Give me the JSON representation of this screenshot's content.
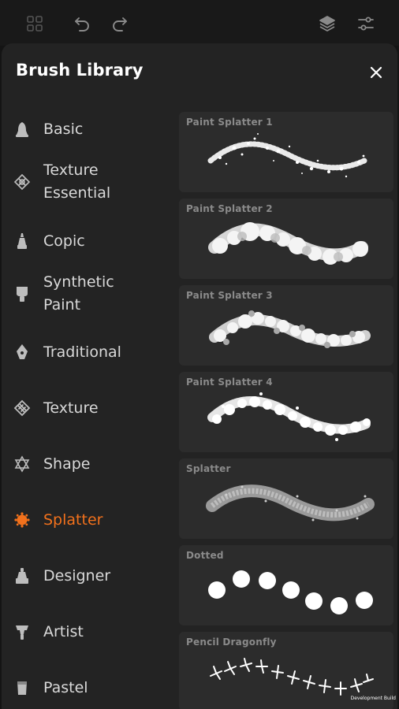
{
  "toolbar": {
    "icons": [
      "grid-icon",
      "undo-icon",
      "redo-icon",
      "layers-icon",
      "adjust-icon"
    ]
  },
  "panel": {
    "title": "Brush Library",
    "close_icon": "close-icon"
  },
  "categories": [
    {
      "label": "Basic",
      "icon": "bell-brush-icon",
      "active": false
    },
    {
      "label": "Texture\nEssential",
      "icon": "texture-essential-icon",
      "active": false
    },
    {
      "label": "Copic",
      "icon": "copic-marker-icon",
      "active": false
    },
    {
      "label": "Synthetic\nPaint",
      "icon": "paint-brush-icon",
      "active": false
    },
    {
      "label": "Traditional",
      "icon": "pen-nib-icon",
      "active": false
    },
    {
      "label": "Texture",
      "icon": "texture-icon",
      "active": false
    },
    {
      "label": "Shape",
      "icon": "shape-icon",
      "active": false
    },
    {
      "label": "Splatter",
      "icon": "splatter-icon",
      "active": true
    },
    {
      "label": "Designer",
      "icon": "designer-icon",
      "active": false
    },
    {
      "label": "Artist",
      "icon": "artist-icon",
      "active": false
    },
    {
      "label": "Pastel",
      "icon": "pastel-icon",
      "active": false
    }
  ],
  "brushes": [
    {
      "name": "Paint Splatter 1"
    },
    {
      "name": "Paint Splatter 2"
    },
    {
      "name": "Paint Splatter 3"
    },
    {
      "name": "Paint Splatter 4"
    },
    {
      "name": "Splatter"
    },
    {
      "name": "Dotted"
    },
    {
      "name": "Pencil Dragonfly"
    }
  ],
  "footer": {
    "dev_build": "Development Build"
  },
  "colors": {
    "accent": "#f2711c",
    "panel": "#232323",
    "card": "#2c2c2c",
    "text": "#d9d9d9"
  }
}
